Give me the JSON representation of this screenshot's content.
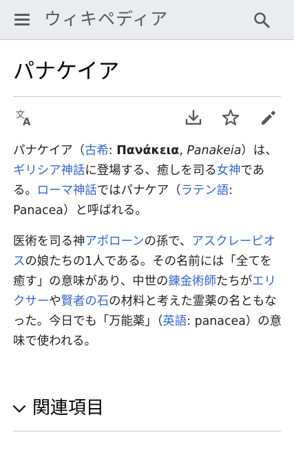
{
  "header": {
    "wordmark": "ウィキペディア",
    "menu_icon": "hamburger-menu-icon",
    "search_icon": "search-icon"
  },
  "title": "パナケイア",
  "toolbar": {
    "language_icon": "translate-icon",
    "download_icon": "download-icon",
    "watch_icon": "star-icon",
    "edit_icon": "pencil-icon"
  },
  "article": {
    "p1": {
      "t1": "パナケイア（",
      "l_greek": "古希",
      "t2": ": ",
      "greek_name": "Πανάκεια",
      "t3": ", ",
      "romanized": "Panakeia",
      "t4": "）は、",
      "l_greek_myth": "ギリシア神話",
      "t5": "に登場する、癒しを司る",
      "l_goddess": "女神",
      "t6": "である。",
      "l_roman_myth": "ローマ神話",
      "t7": "ではパナケア（",
      "l_latin": "ラテン語",
      "t8": ": Panacea）と呼ばれる。"
    },
    "p2": {
      "t1": "医術を司る神",
      "l_apollo": "アポローン",
      "t2": "の孫で、",
      "l_asclepius": "アスクレーピオス",
      "t3": "の娘たちの1人である。その名前には「全てを癒す」の意味があり、中世の",
      "l_alchemist": "錬金術師",
      "t4": "たちが",
      "l_elixir": "エリクサー",
      "t5": "や",
      "l_stone": "賢者の石",
      "t6": "の材料と考えた霊薬の名ともなった。今日でも「万能薬」（",
      "l_english": "英語",
      "t7": ": panacea）の意味で使われる。"
    }
  },
  "section": {
    "title": "関連項目",
    "icon": "chevron-down-icon"
  },
  "colors": {
    "link": "#3366cc",
    "header_bg": "#eaecf0",
    "text": "#202122",
    "icon": "#54595d"
  }
}
